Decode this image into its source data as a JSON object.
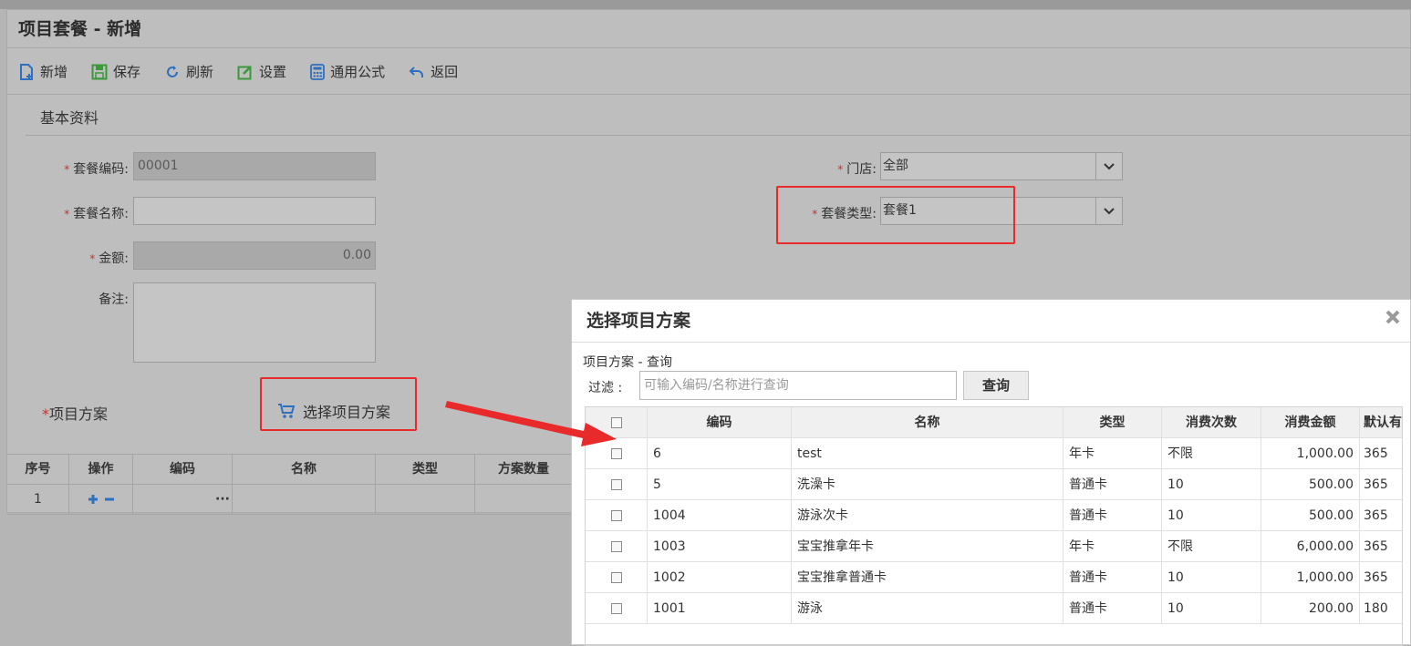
{
  "page": {
    "title": "项目套餐 - 新增"
  },
  "toolbar": {
    "new_label": "新增",
    "save_label": "保存",
    "refresh_label": "刷新",
    "settings_label": "设置",
    "formula_label": "通用公式",
    "back_label": "返回"
  },
  "basic": {
    "section_title": "基本资料",
    "code_label": "套餐编码:",
    "code_value": "00001",
    "name_label": "套餐名称:",
    "name_value": "",
    "amount_label": "金额:",
    "amount_value": "0.00",
    "remark_label": "备注:",
    "store_label": "门店:",
    "store_value": "全部",
    "type_label": "套餐类型:",
    "type_value": "套餐1",
    "required_mark": "*"
  },
  "plan": {
    "label": "项目方案",
    "choose_button": "选择项目方案",
    "columns": [
      "序号",
      "操作",
      "编码",
      "名称",
      "类型",
      "方案数量"
    ],
    "rows": [
      {
        "index": "1",
        "more": "···"
      }
    ]
  },
  "dialog": {
    "title": "选择项目方案",
    "subtitle": "项目方案 - 查询",
    "filter_label": "过滤 :",
    "filter_placeholder": "可输入编码/名称进行查询",
    "query_button": "查询",
    "columns": [
      "编码",
      "名称",
      "类型",
      "消费次数",
      "消费金额",
      "默认有"
    ],
    "rows": [
      {
        "code": "6",
        "name": "test",
        "type": "年卡",
        "times": "不限",
        "amount": "1,000.00",
        "days": "365"
      },
      {
        "code": "5",
        "name": "洗澡卡",
        "type": "普通卡",
        "times": "10",
        "amount": "500.00",
        "days": "365"
      },
      {
        "code": "1004",
        "name": "游泳次卡",
        "type": "普通卡",
        "times": "10",
        "amount": "500.00",
        "days": "365"
      },
      {
        "code": "1003",
        "name": "宝宝推拿年卡",
        "type": "年卡",
        "times": "不限",
        "amount": "6,000.00",
        "days": "365"
      },
      {
        "code": "1002",
        "name": "宝宝推拿普通卡",
        "type": "普通卡",
        "times": "10",
        "amount": "1,000.00",
        "days": "365"
      },
      {
        "code": "1001",
        "name": "游泳",
        "type": "普通卡",
        "times": "10",
        "amount": "200.00",
        "days": "180"
      }
    ]
  },
  "colors": {
    "accent_red": "#e82a2a",
    "icon_blue": "#2f6fbf",
    "icon_green": "#3a9a3a"
  }
}
